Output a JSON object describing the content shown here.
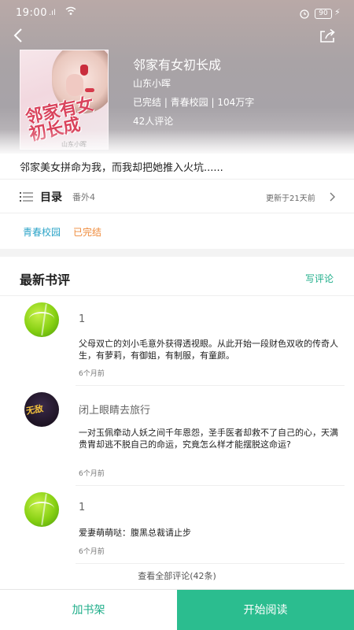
{
  "status_bar": {
    "time": "19:00",
    "signal": ".ıl",
    "battery": "90"
  },
  "book": {
    "title": "邻家有女初长成",
    "author": "山东小晖",
    "meta": "已完结 | 青春校园 | 104万字",
    "review_count": "42人评论",
    "cover_title": "邻家有女初长成",
    "cover_author": "山东小晖",
    "intro": "邻家美女拼命为我，而我却把她推入火坑......"
  },
  "toc": {
    "label": "目录",
    "latest": "番外4",
    "update": "更新于21天前"
  },
  "tags": [
    "青春校园",
    "已完结"
  ],
  "reviews_section": {
    "title": "最新书评",
    "write_label": "写评论"
  },
  "reviews": [
    {
      "name": "1",
      "content": "父母双亡的刘小毛意外获得透视眼。从此开始一段财色双收的传奇人生，有萝莉，有御姐，有制服，有童颜。",
      "time": "6个月前"
    },
    {
      "name": "闭上眼睛去旅行",
      "content": "一对玉佩牵动人妖之间千年恩怨，圣手医者却救不了自己的心，天满贵胄却逃不脱自己的命运，究竟怎么样才能摆脱这命运?",
      "time": "6个月前",
      "avatar_text": "无敌"
    },
    {
      "name": "1",
      "content": "爱妻萌萌哒：腹黑总裁请止步",
      "time": "6个月前"
    }
  ],
  "all_reviews_label": "查看全部评论(42条)",
  "bottom": {
    "shelf_label": "加书架",
    "read_label": "开始阅读"
  },
  "colors": {
    "accent": "#2bbd8f",
    "accent_text": "#1fae8a",
    "tag_blue": "#2aa3c7",
    "tag_orange": "#ef8a3a"
  }
}
